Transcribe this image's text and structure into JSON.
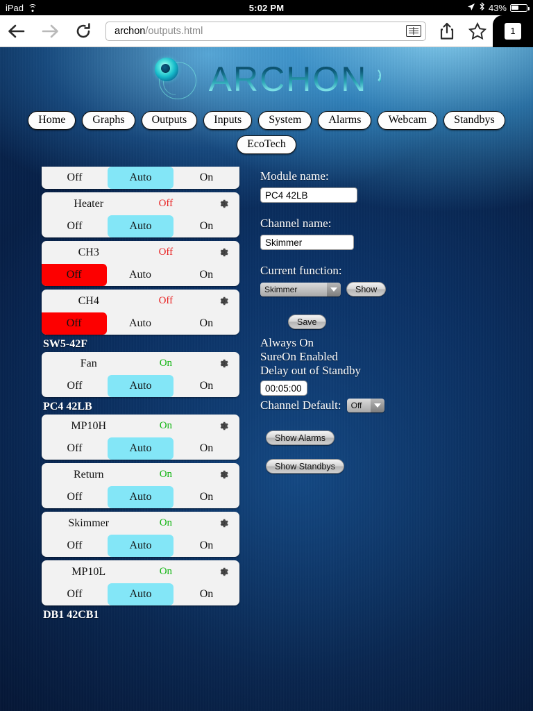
{
  "status_bar": {
    "device": "iPad",
    "wifi_icon": "wifi-icon",
    "time": "5:02 PM",
    "location_icon": "location-arrow-icon",
    "bluetooth_icon": "bluetooth-icon",
    "battery_percent": "43%",
    "battery_level": 43
  },
  "browser": {
    "back_icon": "back-arrow-icon",
    "forward_icon": "forward-arrow-icon",
    "reload_icon": "reload-icon",
    "url_host": "archon",
    "url_path": "/outputs.html",
    "reader_icon": "reader-view-icon",
    "share_icon": "share-icon",
    "bookmark_icon": "bookmark-star-icon",
    "tab_count": "1"
  },
  "site": {
    "logo_text": "ARCHON",
    "nav_row1": [
      "Home",
      "Graphs",
      "Outputs",
      "Inputs",
      "System",
      "Alarms",
      "Webcam",
      "Standbys"
    ],
    "nav_row2": [
      "EcoTech"
    ]
  },
  "outputs": {
    "groups": [
      {
        "label": "",
        "clipped_top": true,
        "channels": [
          {
            "name": "",
            "status": "",
            "status_state": "",
            "mode": "Auto",
            "clipped": true,
            "segments": [
              "Off",
              "Auto",
              "On"
            ]
          }
        ]
      },
      {
        "label": "",
        "channels": [
          {
            "name": "Heater",
            "status": "Off",
            "status_state": "off",
            "mode": "Auto",
            "segments": [
              "Off",
              "Auto",
              "On"
            ],
            "gear_icon": "gear-icon"
          },
          {
            "name": "CH3",
            "status": "Off",
            "status_state": "off",
            "mode": "Off",
            "segments": [
              "Off",
              "Auto",
              "On"
            ],
            "gear_icon": "gear-icon"
          },
          {
            "name": "CH4",
            "status": "Off",
            "status_state": "off",
            "mode": "Off",
            "segments": [
              "Off",
              "Auto",
              "On"
            ],
            "gear_icon": "gear-icon"
          }
        ]
      },
      {
        "label": "SW5-42F",
        "channels": [
          {
            "name": "Fan",
            "status": "On",
            "status_state": "on",
            "mode": "Auto",
            "segments": [
              "Off",
              "Auto",
              "On"
            ],
            "gear_icon": "gear-icon"
          }
        ]
      },
      {
        "label": "PC4 42LB",
        "channels": [
          {
            "name": "MP10H",
            "status": "On",
            "status_state": "on",
            "mode": "Auto",
            "segments": [
              "Off",
              "Auto",
              "On"
            ],
            "gear_icon": "gear-icon"
          },
          {
            "name": "Return",
            "status": "On",
            "status_state": "on",
            "mode": "Auto",
            "segments": [
              "Off",
              "Auto",
              "On"
            ],
            "gear_icon": "gear-icon"
          },
          {
            "name": "Skimmer",
            "status": "On",
            "status_state": "on",
            "mode": "Auto",
            "segments": [
              "Off",
              "Auto",
              "On"
            ],
            "gear_icon": "gear-icon"
          },
          {
            "name": "MP10L",
            "status": "On",
            "status_state": "on",
            "mode": "Auto",
            "segments": [
              "Off",
              "Auto",
              "On"
            ],
            "gear_icon": "gear-icon"
          }
        ]
      },
      {
        "label": "DB1 42CB1",
        "clipped_bottom": true,
        "channels": []
      }
    ]
  },
  "details": {
    "module_name_label": "Module name:",
    "module_name_value": "PC4 42LB",
    "channel_name_label": "Channel name:",
    "channel_name_value": "Skimmer",
    "current_function_label": "Current function:",
    "current_function_value": "Skimmer",
    "show_button": "Show",
    "save_button": "Save",
    "always_on_text": "Always On",
    "sureon_text": "SureOn Enabled",
    "delay_label": "Delay out of Standby",
    "delay_value": "00:05:00",
    "channel_default_label": "Channel Default:",
    "channel_default_value": "Off",
    "show_alarms_button": "Show Alarms",
    "show_standbys_button": "Show Standbys"
  },
  "colors": {
    "auto_selected": "#83e6f7",
    "off_selected": "#fd0000",
    "status_on": "#12b512",
    "status_off": "#e82020",
    "card_bg": "#f2f2f2"
  }
}
